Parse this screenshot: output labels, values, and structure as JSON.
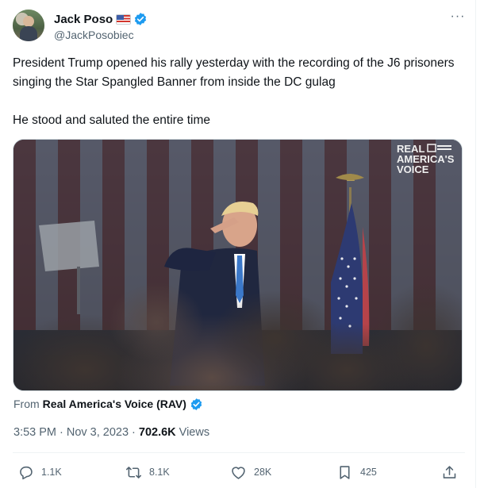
{
  "author": {
    "display_name": "Jack Poso",
    "handle": "@JackPosobiec",
    "flag_icon": "us-flag-icon",
    "verified_color": "#1d9bf0"
  },
  "menu": {
    "more_label": "···"
  },
  "tweet": {
    "text": "President Trump opened his rally yesterday with the recording of the J6 prisoners singing the Star Spangled Banner from inside the DC gulag\n\nHe stood and saluted the entire time"
  },
  "media": {
    "watermark_line1": "REAL",
    "watermark_line2": "AMERICA'S",
    "watermark_line3": "VOICE"
  },
  "attribution": {
    "prefix": "From",
    "source": "Real America's Voice (RAV)"
  },
  "meta": {
    "time": "3:53 PM",
    "separator1": "·",
    "date": "Nov 3, 2023",
    "separator2": "·",
    "views": "702.6K",
    "views_label": "Views"
  },
  "actions": {
    "replies": "1.1K",
    "reposts": "8.1K",
    "likes": "28K",
    "bookmarks": "425"
  },
  "colors": {
    "text_primary": "#0f1419",
    "text_secondary": "#536471",
    "accent": "#1d9bf0"
  }
}
